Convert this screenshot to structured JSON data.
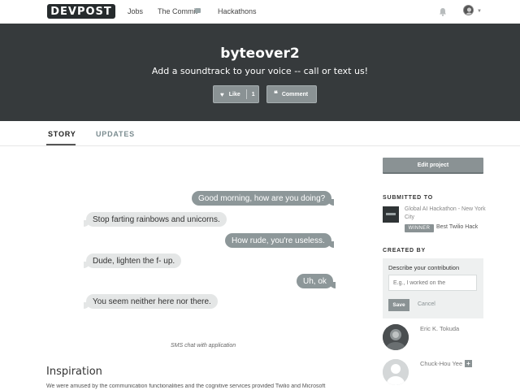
{
  "nav": {
    "logo": "DEVPOST",
    "links": [
      "Jobs",
      "The Commit",
      "Hackathons"
    ]
  },
  "hero": {
    "title": "byteover2",
    "subtitle": "Add a soundtrack to your voice -- call or text us!",
    "like_label": "Like",
    "like_count": "1",
    "comment_label": "Comment"
  },
  "tabs": [
    "STORY",
    "UPDATES"
  ],
  "chat": {
    "messages": [
      {
        "side": "right",
        "text": "Good morning, how are you doing?"
      },
      {
        "side": "left",
        "text": "Stop farting rainbows and unicorns."
      },
      {
        "side": "right",
        "text": "How rude, you're useless."
      },
      {
        "side": "left",
        "text": "Dude, lighten the f- up."
      },
      {
        "side": "right",
        "text": "Uh, ok"
      },
      {
        "side": "left",
        "text": "You seem neither here nor there."
      }
    ],
    "caption": "SMS chat with application"
  },
  "story": {
    "heading": "Inspiration",
    "text": "We were amused by the communication functionalities and the cognitive services provided Twilio and Microsoft"
  },
  "sidebar": {
    "edit_label": "Edit project",
    "submitted_heading": "SUBMITTED TO",
    "hackathon": "Global AI Hackathon - New York City",
    "winner_badge": "WINNER",
    "prize": "Best Twilio Hack",
    "created_heading": "CREATED BY",
    "contribution_title": "Describe your contribution",
    "contribution_placeholder": "E.g., I worked on the",
    "save_label": "Save",
    "cancel_label": "Cancel",
    "members": [
      "Eric K. Tokuda",
      "Chuck-Hou Yee"
    ]
  },
  "colors": {
    "hero_bg": "#363a3c",
    "button_gray": "#8a9294",
    "bubble_out": "#8d9799",
    "bubble_in": "#e4e6e6"
  },
  "icons": [
    "heart-icon",
    "quote-icon",
    "bell-icon",
    "chevron-down-icon",
    "plus-icon",
    "mail-icon"
  ]
}
